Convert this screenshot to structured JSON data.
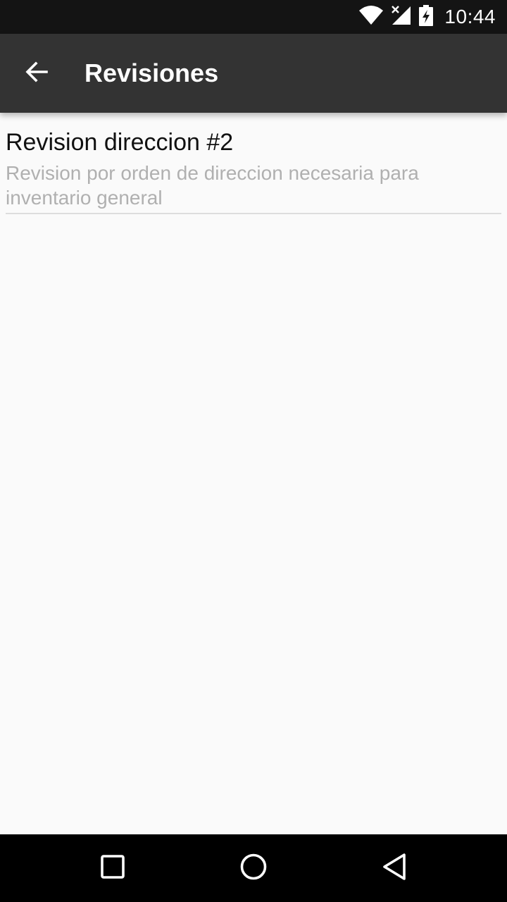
{
  "status_bar": {
    "time": "10:44",
    "icons": [
      "wifi-icon",
      "no-signal-icon",
      "battery-charging-icon"
    ]
  },
  "app_bar": {
    "title": "Revisiones",
    "back_icon": "arrow-back-icon"
  },
  "list": {
    "items": [
      {
        "title": "Revision direccion #2",
        "subtitle": "Revision por orden de direccion necesaria para inventario general"
      }
    ]
  },
  "nav_bar": {
    "buttons": [
      "recents-icon",
      "home-icon",
      "back-triangle-icon"
    ]
  },
  "colors": {
    "status_bar": "#141414",
    "app_bar": "#333333",
    "background": "#fafafa",
    "subtitle_text": "#b0b0b0",
    "nav_bar": "#000000"
  }
}
